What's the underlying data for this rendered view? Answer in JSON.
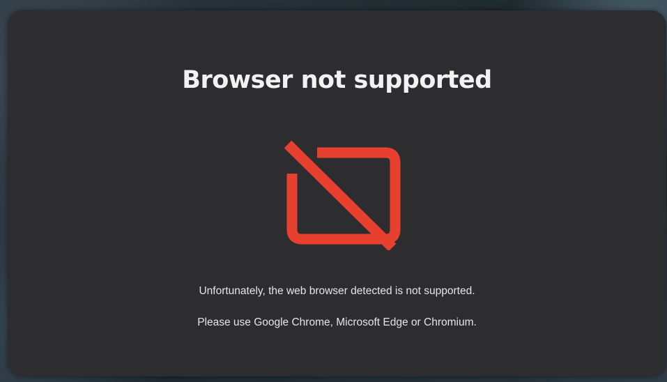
{
  "dialog": {
    "title": "Browser not supported",
    "icon": "screen-off-icon",
    "icon_color": "#e8402f",
    "message_line1": "Unfortunately, the web browser detected is not supported.",
    "message_line2": "Please use Google Chrome, Microsoft Edge or Chromium."
  },
  "colors": {
    "dialog_background": "#2d2d30",
    "title_text": "#f2f2f2",
    "body_text": "#e6e6e6",
    "accent": "#e8402f"
  }
}
